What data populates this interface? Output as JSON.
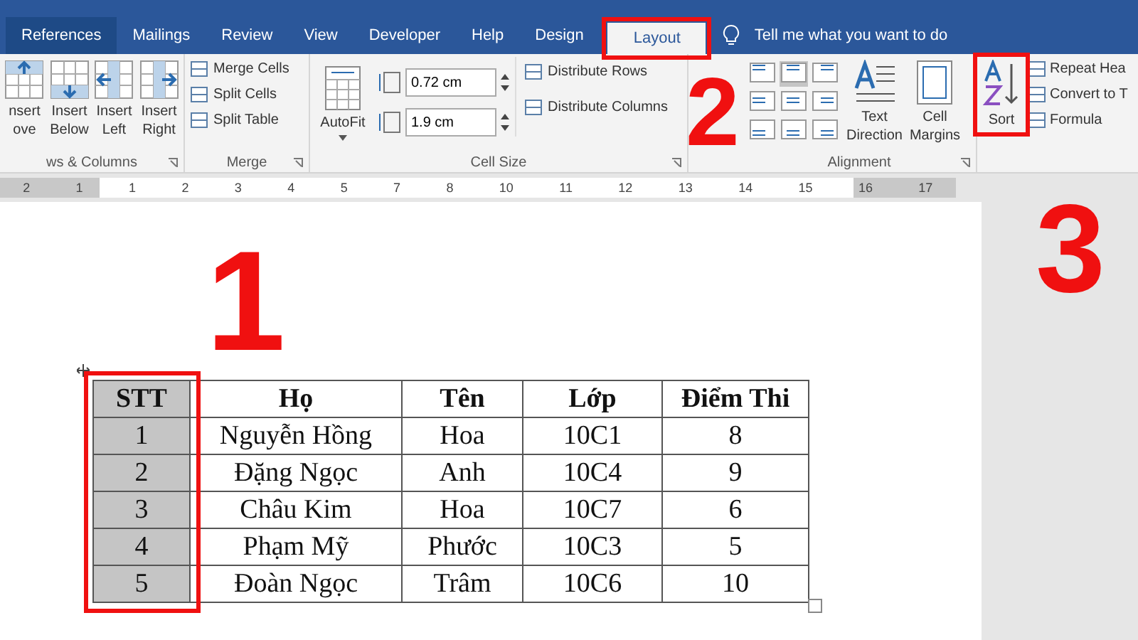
{
  "tabs": [
    {
      "label": "References",
      "selected": false
    },
    {
      "label": "Mailings",
      "selected": false
    },
    {
      "label": "Review",
      "selected": false
    },
    {
      "label": "View",
      "selected": false
    },
    {
      "label": "Developer",
      "selected": false
    },
    {
      "label": "Help",
      "selected": false
    },
    {
      "label": "Design",
      "selected": false
    },
    {
      "label": "Layout",
      "selected": true
    }
  ],
  "tell_me": {
    "placeholder": "Tell me what you want to do"
  },
  "ribbon": {
    "rows_columns": {
      "label": "ws & Columns",
      "buttons": [
        {
          "lines": [
            "nsert",
            "ove"
          ]
        },
        {
          "lines": [
            "Insert",
            "Below"
          ]
        },
        {
          "lines": [
            "Insert",
            "Left"
          ]
        },
        {
          "lines": [
            "Insert",
            "Right"
          ]
        }
      ]
    },
    "merge": {
      "label": "Merge",
      "buttons": [
        "Merge Cells",
        "Split Cells",
        "Split Table"
      ]
    },
    "cell_size": {
      "label": "Cell Size",
      "autofit": "AutoFit",
      "height": "0.72 cm",
      "width": "1.9 cm",
      "buttons": [
        "Distribute Rows",
        "Distribute Columns"
      ]
    },
    "alignment": {
      "label": "Alignment",
      "grid": [
        {
          "selected": false
        },
        {
          "selected": true
        },
        {
          "selected": false
        },
        {
          "selected": false
        },
        {
          "selected": false
        },
        {
          "selected": false
        },
        {
          "selected": false
        },
        {
          "selected": false
        },
        {
          "selected": false
        }
      ],
      "buttons": [
        {
          "lines": [
            "Text",
            "Direction"
          ]
        },
        {
          "lines": [
            "Cell",
            "Margins"
          ]
        }
      ]
    },
    "data": {
      "sort": "Sort",
      "buttons": [
        "Repeat Hea",
        "Convert to T",
        "Formula"
      ]
    }
  },
  "ruler": {
    "labels": [
      "2",
      "1",
      "1",
      "2",
      "3",
      "4",
      "5",
      "7",
      "8",
      "10",
      "11",
      "12",
      "13",
      "14",
      "15",
      "16",
      "17"
    ]
  },
  "table": {
    "columns": [
      {
        "label": "STT",
        "selected": true
      },
      {
        "label": "Họ",
        "selected": false
      },
      {
        "label": "Tên",
        "selected": false
      },
      {
        "label": "Lớp",
        "selected": false
      },
      {
        "label": "Điểm Thi",
        "selected": false
      }
    ],
    "rows": [
      [
        "1",
        "Nguyễn Hồng",
        "Hoa",
        "10C1",
        "8"
      ],
      [
        "2",
        "Đặng Ngọc",
        "Anh",
        "10C4",
        "9"
      ],
      [
        "3",
        "Châu Kim",
        "Hoa",
        "10C7",
        "6"
      ],
      [
        "4",
        "Phạm Mỹ",
        "Phước",
        "10C3",
        "5"
      ],
      [
        "5",
        "Đoàn Ngọc",
        "Trâm",
        "10C6",
        "10"
      ]
    ]
  },
  "annotations": [
    "1",
    "2",
    "3"
  ]
}
